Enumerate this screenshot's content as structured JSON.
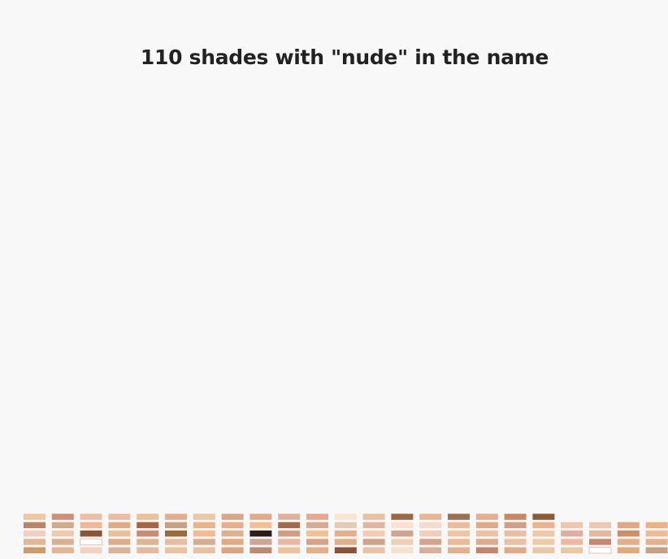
{
  "title": "110 shades with \"nude\" in the name",
  "chart_data": {
    "type": "swatch-grid",
    "title": "110 shades with \"nude\" in the name",
    "count": 110,
    "columns": [
      [
        "#cf9a6a",
        "#e3b795",
        "#edd0bd",
        "#b98468",
        "#f2c6a0"
      ],
      [
        "#e2b593",
        "#d8b092",
        "#eecab0",
        "#d2ab8c",
        "#cf8e76"
      ],
      [
        "#f2d3c1",
        "#ffffff",
        "#8b5432",
        "#eeb897",
        "#ecbfa3"
      ],
      [
        "#d9b399",
        "#dbac86",
        "#eabf99",
        "#e0ac86",
        "#e9bda2"
      ],
      [
        "#e8b7a0",
        "#deb691",
        "#c78c73",
        "#a86543",
        "#ecc19a"
      ],
      [
        "#ecc2a5",
        "#e9bb9f",
        "#9b6b3b",
        "#c6a283",
        "#e3ae8b"
      ],
      [
        "#e9bfa4",
        "#dbac8f",
        "#f2ba92",
        "#e7b48c",
        "#e9c8a6"
      ],
      [
        "#dba57f",
        "#e1aa80",
        "#dcb293",
        "#e8b08a",
        "#d9a68b"
      ],
      [
        "#bc8a71",
        "#cda693",
        "#2d1c1a",
        "#f0c093",
        "#ddae86"
      ],
      [
        "#efc29b",
        "#e8b8a1",
        "#d29e81",
        "#a4694a",
        "#dfb298"
      ],
      [
        "#e7ad86",
        "#d7a385",
        "#f2c198",
        "#d5ac91",
        "#e6a98d"
      ],
      [
        "#8d5236",
        "#dfb187",
        "#e3af8b",
        "#e1cdb5",
        "#fbe5d0"
      ],
      [
        "#e7c3a8",
        "#d1a18a",
        "#f3cdae",
        "#dfb79e",
        "#e9c0a0"
      ],
      [
        "#f8e1cb",
        "#efd0b3",
        "#cfa68c",
        "#fde1cf",
        "#9b6a45"
      ],
      [
        "#d7b099",
        "#d4a58b",
        "#f3cdbb",
        "#f4dbcb",
        "#e7b694"
      ],
      [
        "#e3b08d",
        "#ecbb94",
        "#efc4a3",
        "#e8bf9c",
        "#9a7150"
      ],
      [
        "#c38469",
        "#dbab8c",
        "#ecc1a3",
        "#dfaa8c",
        "#e4ae8f"
      ],
      [
        "#e3ab85",
        "#ebc1a3",
        "#e9c0a3",
        "#cfa287",
        "#c7895e"
      ],
      [
        "#e9c8a9",
        "#f1caa6",
        "#eac8a8",
        "#e7b48b",
        "#8c5b36"
      ],
      [
        "#e9c9a3",
        "#f0b8a1",
        "#dfaea1",
        "#eec6ad"
      ],
      [
        "#ffffff",
        "#c98970",
        "#e3b7a0",
        "#ecc8b3"
      ],
      [
        "#e1aa79",
        "#e6ad8a",
        "#c98f66",
        "#e1a983"
      ],
      [
        "#c6a081",
        "#e6b08a",
        "#ecbb96",
        "#ebb287"
      ]
    ]
  }
}
